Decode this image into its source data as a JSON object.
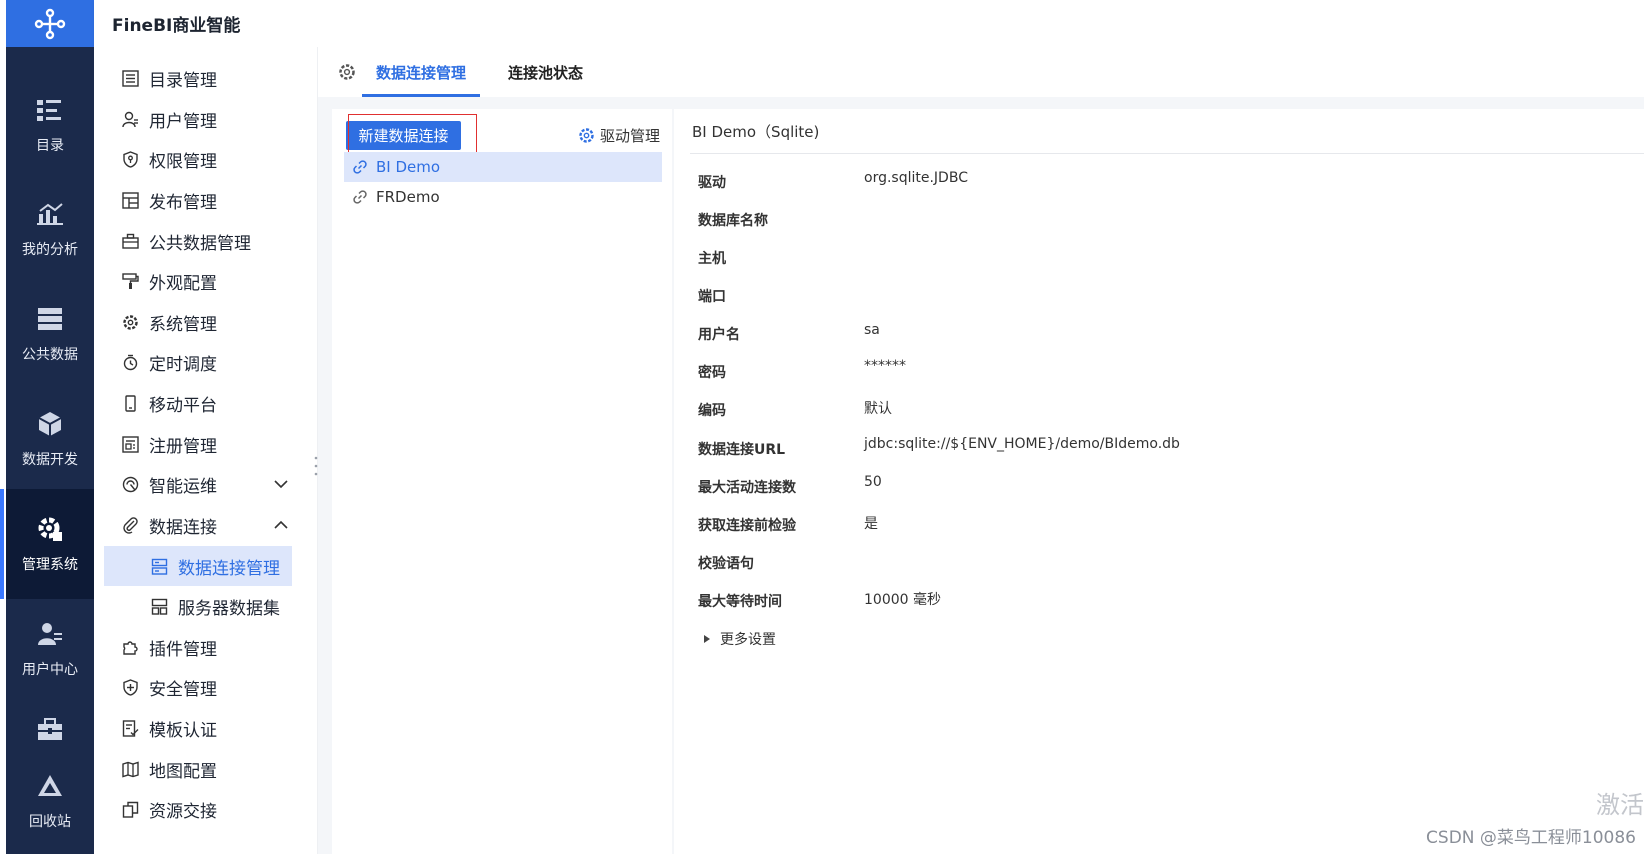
{
  "app": {
    "brand": "FineBI商业智能"
  },
  "rail": {
    "items": [
      {
        "label": "目录",
        "icon": "catalog-icon"
      },
      {
        "label": "我的分析",
        "icon": "analysis-icon"
      },
      {
        "label": "公共数据",
        "icon": "public-data-icon"
      },
      {
        "label": "数据开发",
        "icon": "data-dev-icon"
      },
      {
        "label": "管理系统",
        "icon": "manage-icon",
        "active": true
      },
      {
        "label": "用户中心",
        "icon": "user-center-icon"
      },
      {
        "label": "回收站",
        "icon": "recycle-icon"
      }
    ]
  },
  "sidebar": {
    "items": [
      {
        "label": "目录管理",
        "icon": "list-icon"
      },
      {
        "label": "用户管理",
        "icon": "user-icon"
      },
      {
        "label": "权限管理",
        "icon": "shield-icon"
      },
      {
        "label": "发布管理",
        "icon": "publish-icon"
      },
      {
        "label": "公共数据管理",
        "icon": "briefcase-icon"
      },
      {
        "label": "外观配置",
        "icon": "brush-icon"
      },
      {
        "label": "系统管理",
        "icon": "gear-icon"
      },
      {
        "label": "定时调度",
        "icon": "timer-icon"
      },
      {
        "label": "移动平台",
        "icon": "mobile-icon"
      },
      {
        "label": "注册管理",
        "icon": "register-icon"
      },
      {
        "label": "智能运维",
        "icon": "ops-icon"
      },
      {
        "label": "数据连接",
        "icon": "paperclip-icon"
      },
      {
        "label": "数据连接管理",
        "icon": "server-icon"
      },
      {
        "label": "服务器数据集",
        "icon": "server-dataset-icon"
      },
      {
        "label": "插件管理",
        "icon": "puzzle-icon"
      },
      {
        "label": "安全管理",
        "icon": "shield-plus-icon"
      },
      {
        "label": "模板认证",
        "icon": "template-icon"
      },
      {
        "label": "地图配置",
        "icon": "map-icon"
      },
      {
        "label": "资源交接",
        "icon": "handover-icon"
      }
    ]
  },
  "tabs": [
    {
      "label": "数据连接管理",
      "active": true
    },
    {
      "label": "连接池状态"
    }
  ],
  "left_panel": {
    "new_button": "新建数据连接",
    "driver_button": "驱动管理",
    "connections": [
      {
        "name": "BI Demo",
        "active": true
      },
      {
        "name": "FRDemo"
      }
    ]
  },
  "detail": {
    "title": "BI Demo（Sqlite)",
    "fields": [
      {
        "label": "驱动",
        "value": "org.sqlite.JDBC"
      },
      {
        "label": "数据库名称",
        "value": ""
      },
      {
        "label": "主机",
        "value": ""
      },
      {
        "label": "端口",
        "value": ""
      },
      {
        "label": "用户名",
        "value": "sa"
      },
      {
        "label": "密码",
        "value": "******"
      },
      {
        "label": "编码",
        "value": "默认"
      },
      {
        "label": "数据连接URL",
        "value": "jdbc:sqlite://${ENV_HOME}/demo/BIdemo.db"
      },
      {
        "label": "最大活动连接数",
        "value": "50"
      },
      {
        "label": "获取连接前检验",
        "value": "是"
      },
      {
        "label": "校验语句",
        "value": ""
      },
      {
        "label": "最大等待时间",
        "value": "10000 毫秒"
      }
    ],
    "more_settings": "更多设置"
  },
  "overlay": {
    "activate": "激活",
    "watermark": "CSDN @菜鸟工程师10086"
  }
}
